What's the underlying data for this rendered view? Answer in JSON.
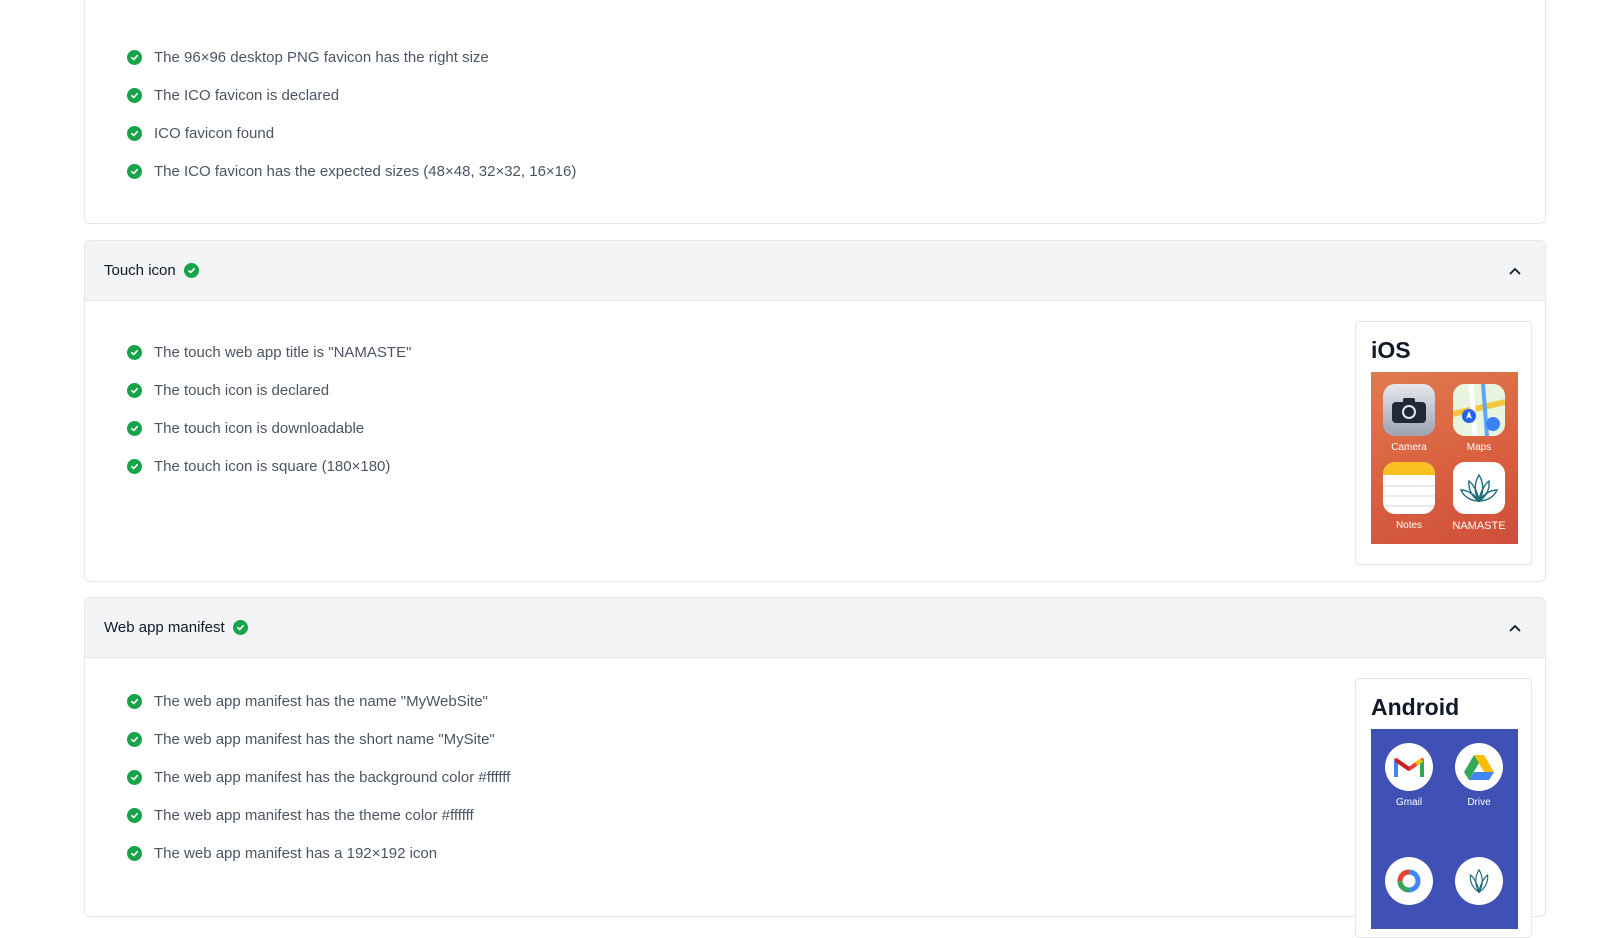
{
  "favicon_checks": [
    "The 96×96 desktop PNG favicon has the right size",
    "The ICO favicon is declared",
    "ICO favicon found",
    "The ICO favicon has the expected sizes (48×48, 32×32, 16×16)"
  ],
  "touch": {
    "title": "Touch icon",
    "checks": [
      "The touch web app title is \"NAMASTE\"",
      "The touch icon is declared",
      "The touch icon is downloadable",
      "The touch icon is square (180×180)"
    ],
    "preview": {
      "platform": "iOS",
      "apps": [
        "Camera",
        "Maps",
        "Notes",
        "NAMASTE"
      ]
    }
  },
  "manifest": {
    "title": "Web app manifest",
    "checks": [
      "The web app manifest has the name \"MyWebSite\"",
      "The web app manifest has the short name \"MySite\"",
      "The web app manifest has the background color #ffffff",
      "The web app manifest has the theme color #ffffff",
      "The web app manifest has a 192×192 icon"
    ],
    "preview": {
      "platform": "Android",
      "apps": [
        "Gmail",
        "Drive"
      ]
    }
  },
  "colors": {
    "success": "#16a34a",
    "header_bg": "#f3f4f6",
    "ios_bg": "#d9603f",
    "android_bg": "#3f51b5"
  }
}
